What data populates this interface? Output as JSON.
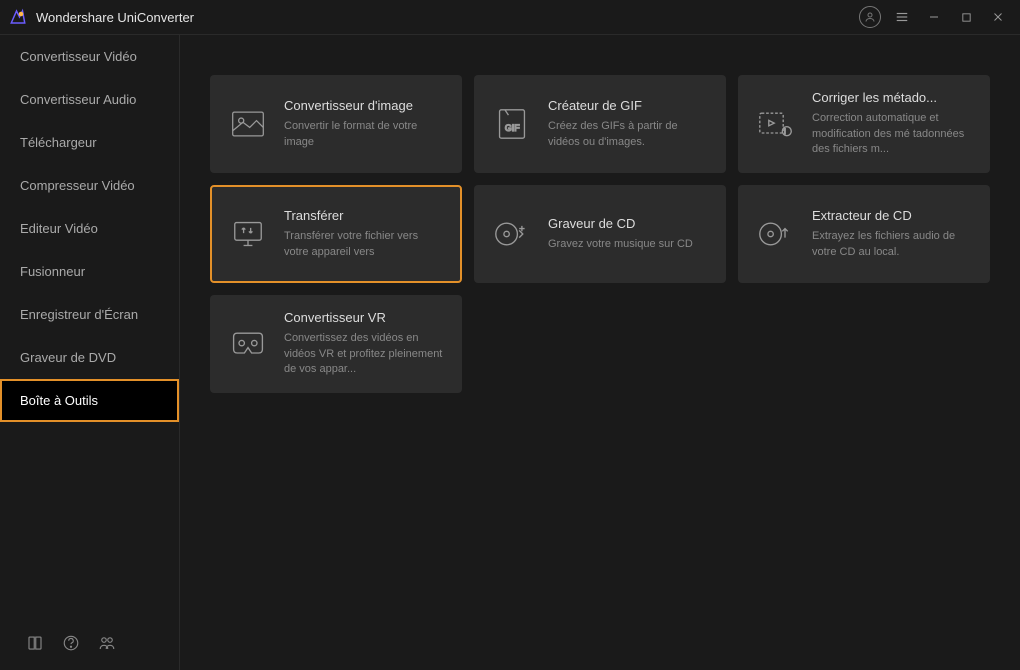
{
  "app": {
    "title": "Wondershare UniConverter"
  },
  "sidebar": {
    "items": [
      {
        "label": "Convertisseur Vidéo"
      },
      {
        "label": "Convertisseur Audio"
      },
      {
        "label": "Téléchargeur"
      },
      {
        "label": "Compresseur Vidéo"
      },
      {
        "label": "Editeur Vidéo"
      },
      {
        "label": "Fusionneur"
      },
      {
        "label": "Enregistreur d'Écran"
      },
      {
        "label": "Graveur de DVD"
      },
      {
        "label": "Boîte à Outils"
      }
    ]
  },
  "tools": [
    {
      "title": "Convertisseur d'image",
      "desc": "Convertir le format de votre image"
    },
    {
      "title": "Créateur de GIF",
      "desc": "Créez des GIFs à partir de vidéos ou d'images."
    },
    {
      "title": "Corriger les métado...",
      "desc": "Correction automatique et modification des mé tadonnées des fichiers m..."
    },
    {
      "title": "Transférer",
      "desc": "Transférer votre fichier vers votre appareil vers"
    },
    {
      "title": "Graveur de CD",
      "desc": "Gravez votre musique sur CD"
    },
    {
      "title": "Extracteur de CD",
      "desc": "Extrayez les fichiers audio de votre CD au local."
    },
    {
      "title": "Convertisseur VR",
      "desc": "Convertissez des vidéos en vidéos VR et profitez pleinement de vos appar..."
    }
  ]
}
